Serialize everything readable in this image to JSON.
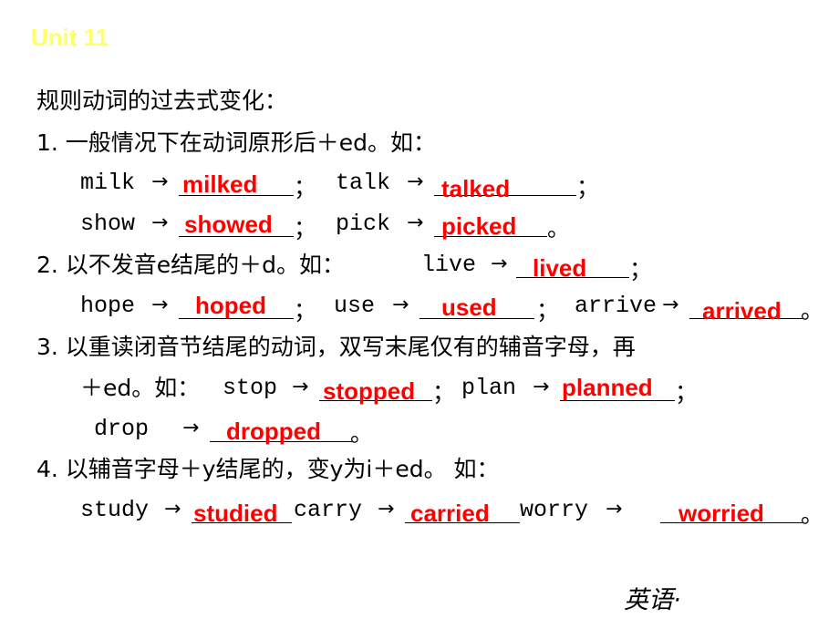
{
  "slide": {
    "title": "Unit 11",
    "title_color": "#ffff66",
    "answer_color": "#ff0000",
    "heading": "规则动词的过去式变化：",
    "rules": [
      {
        "text": "1. 一般情况下在动词原形后＋ed。如：",
        "examples": [
          {
            "base": "milk",
            "answer": "milked",
            "end": "；"
          },
          {
            "base": "talk",
            "answer": "talked",
            "end": "；"
          },
          {
            "base": "show",
            "answer": "showed",
            "end": "；"
          },
          {
            "base": "pick",
            "answer": "picked",
            "end": "。"
          }
        ]
      },
      {
        "text": "2. 以不发音e结尾的＋d。如：",
        "examples": [
          {
            "base": "live",
            "answer": "lived",
            "end": "；"
          },
          {
            "base": "hope",
            "answer": "hoped",
            "end": "；"
          },
          {
            "base": "use",
            "answer": "used",
            "end": "；"
          },
          {
            "base": "arrive",
            "answer": "arrived",
            "end": "。"
          }
        ]
      },
      {
        "text": "3. 以重读闭音节结尾的动词，双写末尾仅有的辅音字母，再",
        "text2": "＋ed。如：",
        "examples": [
          {
            "base": "stop",
            "answer": "stopped",
            "end": "；"
          },
          {
            "base": "plan",
            "answer": "planned",
            "end": "；"
          },
          {
            "base": "drop",
            "answer": "dropped",
            "end": "。"
          }
        ]
      },
      {
        "text": "4. 以辅音字母＋y结尾的，变y为i＋ed。 如：",
        "examples": [
          {
            "base": "study",
            "answer": "studied",
            "end": ""
          },
          {
            "base": "carry",
            "answer": "carried",
            "end": ""
          },
          {
            "base": "worry",
            "answer": "worried",
            "end": "。"
          }
        ]
      }
    ],
    "arrow": "→",
    "footer": "英语·"
  }
}
